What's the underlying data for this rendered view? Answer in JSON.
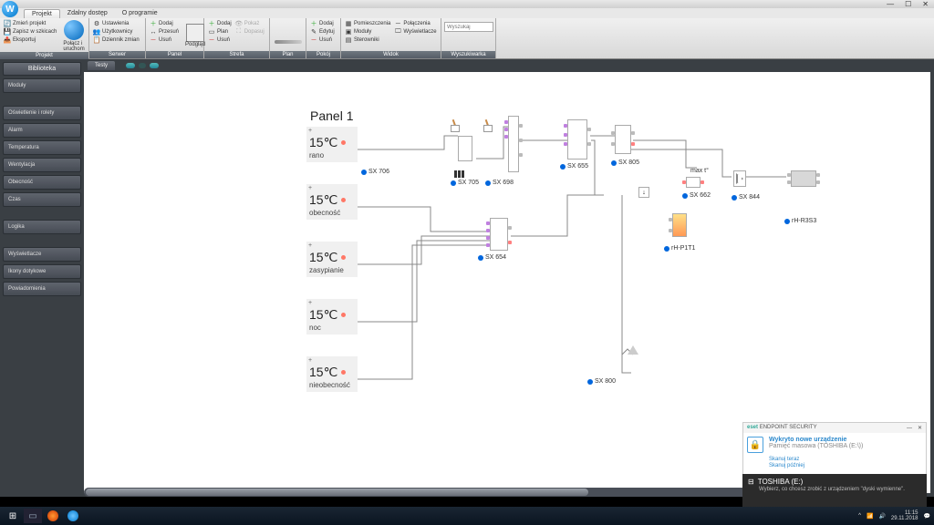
{
  "window": {
    "min": "—",
    "max": "☐",
    "close": "✕"
  },
  "menu_tabs": [
    "Projekt",
    "Zdalny dostęp",
    "O programie"
  ],
  "ribbon": {
    "projekt": {
      "items": [
        "Zmień projekt",
        "Zapisz w szkicach",
        "Eksportuj"
      ],
      "big": "Połącz i uruchom",
      "label": "Projekt"
    },
    "serwer": {
      "items": [
        "Ustawienia",
        "Użytkownicy",
        "Dziennik zmian"
      ],
      "label": "Serwer"
    },
    "panel": {
      "col1": [
        "Dodaj",
        "Przesuń",
        "Usuń"
      ],
      "big": "Podgląd",
      "label": "Panel"
    },
    "strefa": {
      "col1": [
        "Dodaj",
        "Plan",
        "Usuń"
      ],
      "col2": [
        "Pokaż",
        "Dopasuj"
      ],
      "label": "Strefa"
    },
    "plan": {
      "label": "Plan"
    },
    "pokoj": {
      "col1": [
        "Dodaj",
        "Edytuj",
        "Usuń"
      ],
      "label": "Pokój"
    },
    "widok": {
      "col1": [
        "Pomieszczenia",
        "Moduły",
        "Sterowniki"
      ],
      "col2": [
        "Połączenia",
        "Wyświetlacze"
      ],
      "label": "Widok"
    },
    "search": {
      "placeholder": "Wyszukaj",
      "label": "Wyszukiwarka"
    }
  },
  "sidebar": {
    "head": "Biblioteka",
    "items": [
      "Moduły",
      "Oświetlenie i rolety",
      "Alarm",
      "Temperatura",
      "Wentylacja",
      "Obecność",
      "Czas",
      "Logika",
      "Wyświetlacze",
      "Ikony dotykowe",
      "Powiadomienia"
    ]
  },
  "doc_tabs": {
    "main": "Testy"
  },
  "diagram": {
    "panel_title": "Panel 1",
    "setpoints": [
      {
        "value": "15℃",
        "label": "rano"
      },
      {
        "value": "15℃",
        "label": "obecność"
      },
      {
        "value": "15℃",
        "label": "zasypianie"
      },
      {
        "value": "15℃",
        "label": "noc"
      },
      {
        "value": "15℃",
        "label": "nieobecność"
      }
    ],
    "nodes": {
      "sx706": "SX 706",
      "sx705": "SX 705",
      "sx698": "SX 698",
      "sx655": "SX 655",
      "sx805": "SX 805",
      "sx662": "SX 662",
      "sx844": "SX 844",
      "sx654": "SX 654",
      "sx800": "SX 800",
      "p1t1": "rH-P1T1",
      "r3s3": "rH-R3S3"
    },
    "maxt": "max t°"
  },
  "eset": {
    "brand": "ENDPOINT SECURITY",
    "title": "Wykryto nowe urządzenie",
    "subtitle": "Pamięć masowa (TOSHIBA (E:\\))",
    "link1": "Skanuj teraz",
    "link2": "Skanuj później"
  },
  "toast": {
    "title": "TOSHIBA (E:)",
    "body": "Wybierz, co chcesz zrobić z urządzeniem \"dyski wymienne\"."
  },
  "taskbar": {
    "time": "11:15",
    "date": "29.11.2018"
  }
}
